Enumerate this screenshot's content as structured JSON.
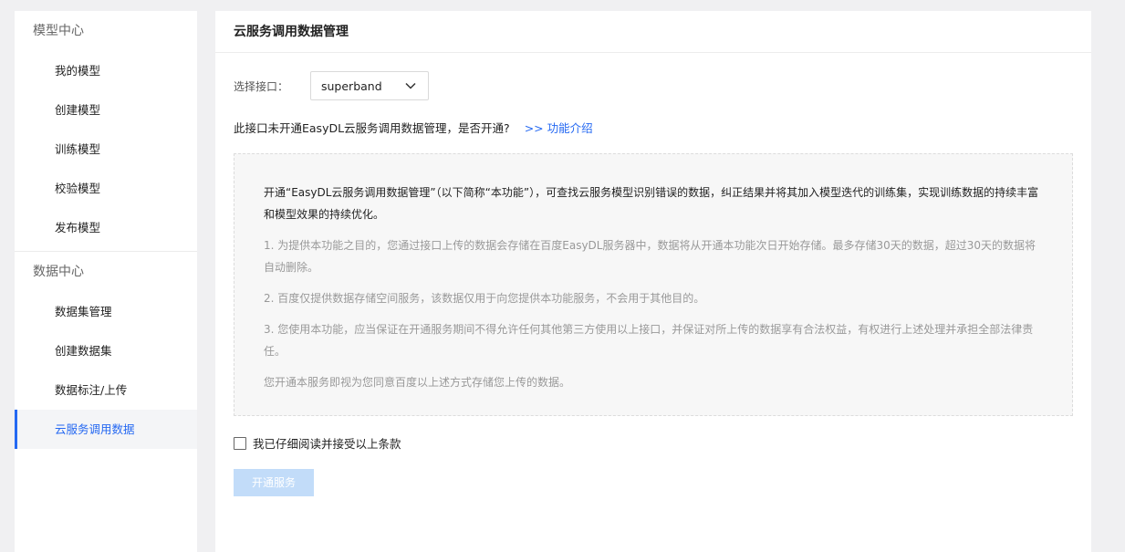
{
  "sidebar": {
    "sections": [
      {
        "title": "模型中心",
        "items": [
          "我的模型",
          "创建模型",
          "训练模型",
          "校验模型",
          "发布模型"
        ]
      },
      {
        "title": "数据中心",
        "items": [
          "数据集管理",
          "创建数据集",
          "数据标注/上传",
          "云服务调用数据"
        ]
      }
    ],
    "active_item": "云服务调用数据"
  },
  "main": {
    "title": "云服务调用数据管理",
    "select_label": "选择接口：",
    "select_value": "superband",
    "notice_text": "此接口未开通EasyDL云服务调用数据管理，是否开通?",
    "notice_link": ">> 功能介绍",
    "terms": {
      "lead": "开通“EasyDL云服务调用数据管理”（以下简称“本功能”），可查找云服务模型识别错误的数据，纠正结果并将其加入模型迭代的训练集，实现训练数据的持续丰富和模型效果的持续优化。",
      "items": [
        "1. 为提供本功能之目的，您通过接口上传的数据会存储在百度EasyDL服务器中，数据将从开通本功能次日开始存储。最多存储30天的数据，超过30天的数据将自动删除。",
        "2. 百度仅提供数据存储空间服务，该数据仅用于向您提供本功能服务，不会用于其他目的。",
        "3. 您使用本功能，应当保证在开通服务期间不得允许任何其他第三方使用以上接口，并保证对所上传的数据享有合法权益，有权进行上述处理并承担全部法律责任。",
        "您开通本服务即视为您同意百度以上述方式存储您上传的数据。"
      ]
    },
    "agree_label": "我已仔细阅读并接受以上条款",
    "agree_checked": false,
    "submit_label": "开通服务"
  },
  "colors": {
    "accent": "#2468f2",
    "button_disabled": "#c2dcf9",
    "background": "#f0f0f2"
  }
}
